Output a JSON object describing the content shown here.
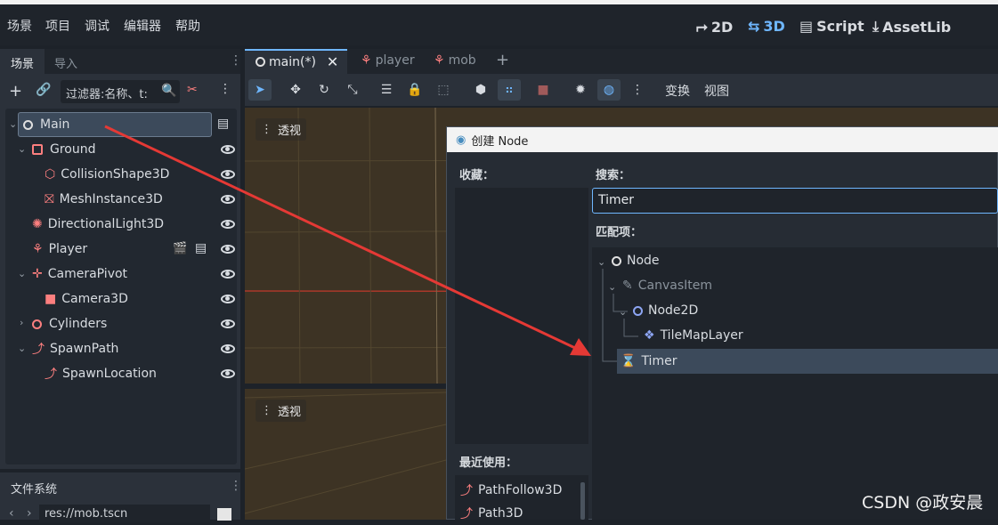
{
  "menu": [
    "场景",
    "项目",
    "调试",
    "编辑器",
    "帮助"
  ],
  "modes": [
    {
      "label": "2D",
      "icon": "2d-icon"
    },
    {
      "label": "3D",
      "icon": "3d-icon"
    },
    {
      "label": "Script",
      "icon": "script-icon"
    },
    {
      "label": "AssetLib",
      "icon": "assetlib-icon"
    }
  ],
  "left_dock": {
    "tabs": [
      "场景",
      "导入"
    ],
    "filter_placeholder": "过滤器:名称、t:",
    "tree": [
      {
        "label": "Main",
        "icon": "node-circle-icon",
        "color": "#e0e0e0"
      },
      {
        "label": "Ground",
        "icon": "static-body-icon",
        "color": "#fc7f7f"
      },
      {
        "label": "CollisionShape3D",
        "icon": "collision-shape-icon",
        "color": "#fc7f7f"
      },
      {
        "label": "MeshInstance3D",
        "icon": "mesh-instance-icon",
        "color": "#fc7f7f"
      },
      {
        "label": "DirectionalLight3D",
        "icon": "light-icon",
        "color": "#fc7f7f"
      },
      {
        "label": "Player",
        "icon": "character-icon",
        "color": "#fc7f7f"
      },
      {
        "label": "CameraPivot",
        "icon": "node3d-icon",
        "color": "#fc7f7f"
      },
      {
        "label": "Camera3D",
        "icon": "camera-icon",
        "color": "#fc7f7f"
      },
      {
        "label": "Cylinders",
        "icon": "node3d-circle-icon",
        "color": "#fc7f7f"
      },
      {
        "label": "SpawnPath",
        "icon": "path-icon",
        "color": "#fc7f7f"
      },
      {
        "label": "SpawnLocation",
        "icon": "path-follow-icon",
        "color": "#fc7f7f"
      }
    ]
  },
  "filesystem": {
    "tab": "文件系统",
    "path": "res://mob.tscn"
  },
  "center_tabs": [
    {
      "label": "main(*)",
      "icon": "node-circle-icon"
    },
    {
      "label": "player",
      "icon": "character-icon"
    },
    {
      "label": "mob",
      "icon": "character-icon"
    }
  ],
  "viewport_toolbar": {
    "transform": "变换",
    "view": "视图"
  },
  "viewport_label": "透视",
  "dialog": {
    "title": "创建 Node",
    "favorites_label": "收藏：",
    "search_label": "搜索：",
    "search_value": "Timer",
    "matches_label": "匹配项：",
    "recent_label": "最近使用：",
    "recent": [
      "PathFollow3D",
      "Path3D"
    ],
    "matches": [
      {
        "label": "Node",
        "icon": "node-circle-icon",
        "color": "#e0e0e0"
      },
      {
        "label": "CanvasItem",
        "icon": "brush-icon",
        "color": "#9aa2ab"
      },
      {
        "label": "Node2D",
        "icon": "node2d-circle-icon",
        "color": "#8da5f3"
      },
      {
        "label": "TileMapLayer",
        "icon": "tilemap-icon",
        "color": "#8da5f3"
      },
      {
        "label": "Timer",
        "icon": "hourglass-icon",
        "color": "#e0e0e0"
      }
    ]
  },
  "watermark": "CSDN @政安晨",
  "accent_color": "#6fb7ff"
}
